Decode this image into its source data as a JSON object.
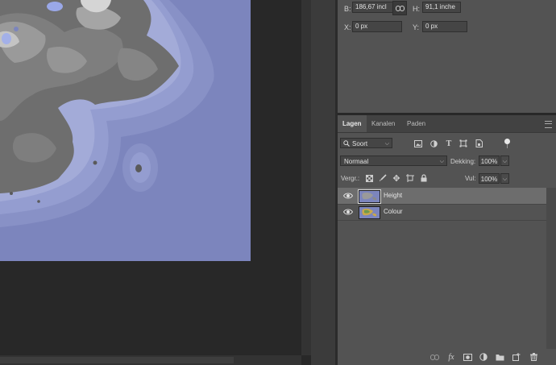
{
  "properties": {
    "width_label": "B:",
    "width_value": "186,67 incl",
    "height_label": "H:",
    "height_value": "91,1 inche",
    "x_label": "X:",
    "x_value": "0 px",
    "y_label": "Y:",
    "y_value": "0 px"
  },
  "layers_panel": {
    "tabs": [
      {
        "label": "Lagen",
        "active": true
      },
      {
        "label": "Kanalen",
        "active": false
      },
      {
        "label": "Paden",
        "active": false
      }
    ],
    "filter_label": "Soort",
    "blend_mode": "Normaal",
    "opacity_label": "Dekking:",
    "opacity_value": "100%",
    "lock_label": "Vergr.:",
    "fill_label": "Vul:",
    "fill_value": "100%",
    "layers": [
      {
        "name": "Height",
        "selected": true,
        "visible": true
      },
      {
        "name": "Colour",
        "selected": false,
        "visible": true
      }
    ]
  },
  "colors": {
    "water": "#7c85bd",
    "panel": "#535353",
    "selected_row": "#6d6d6d"
  }
}
